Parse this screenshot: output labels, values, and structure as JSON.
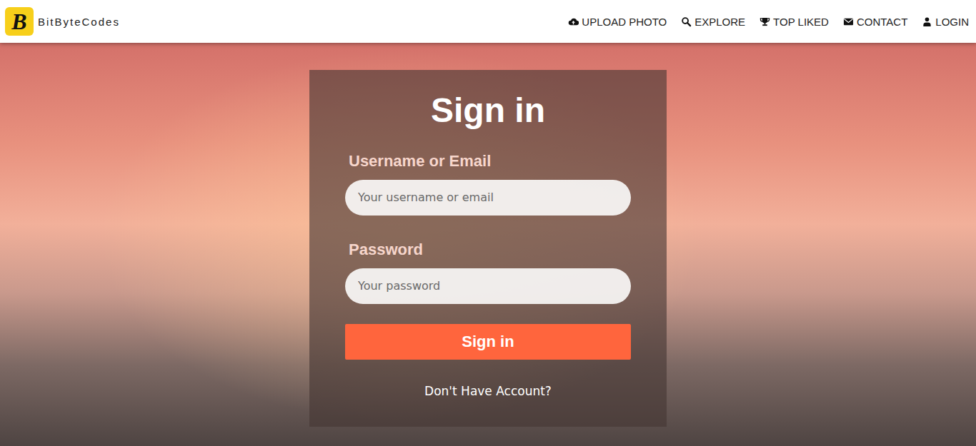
{
  "brand": {
    "initial": "B",
    "name": "BitByteCodes"
  },
  "nav": [
    {
      "label": "UPLOAD PHOTO"
    },
    {
      "label": "EXPLORE"
    },
    {
      "label": "TOP LIKED"
    },
    {
      "label": "CONTACT"
    },
    {
      "label": "LOGIN"
    }
  ],
  "form": {
    "title": "Sign in",
    "fields": [
      {
        "label": "Username or Email",
        "placeholder": "Your username or email"
      },
      {
        "label": "Password",
        "placeholder": "Your password"
      }
    ],
    "button": "Sign in",
    "link": "Don't Have Account?"
  }
}
